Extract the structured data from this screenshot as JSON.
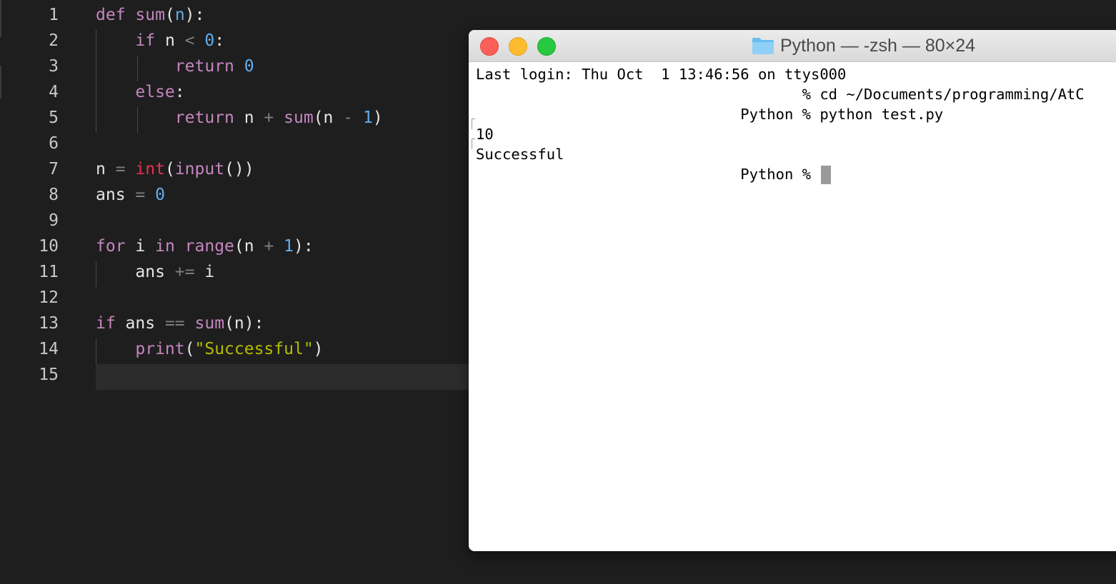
{
  "editor": {
    "line_numbers": [
      "1",
      "2",
      "3",
      "4",
      "5",
      "6",
      "7",
      "8",
      "9",
      "10",
      "11",
      "12",
      "13",
      "14",
      "15"
    ],
    "lines": [
      [
        {
          "t": "kw",
          "v": "def"
        },
        {
          "t": "plain",
          "v": " "
        },
        {
          "t": "fn",
          "v": "sum"
        },
        {
          "t": "plain",
          "v": "("
        },
        {
          "t": "num",
          "v": "n"
        },
        {
          "t": "plain",
          "v": "):"
        }
      ],
      [
        {
          "t": "plain",
          "v": "    "
        },
        {
          "t": "kw",
          "v": "if"
        },
        {
          "t": "plain",
          "v": " n "
        },
        {
          "t": "op",
          "v": "<"
        },
        {
          "t": "plain",
          "v": " "
        },
        {
          "t": "num",
          "v": "0"
        },
        {
          "t": "plain",
          "v": ":"
        }
      ],
      [
        {
          "t": "plain",
          "v": "        "
        },
        {
          "t": "kw",
          "v": "return"
        },
        {
          "t": "plain",
          "v": " "
        },
        {
          "t": "num",
          "v": "0"
        }
      ],
      [
        {
          "t": "plain",
          "v": "    "
        },
        {
          "t": "kw",
          "v": "else"
        },
        {
          "t": "plain",
          "v": ":"
        }
      ],
      [
        {
          "t": "plain",
          "v": "        "
        },
        {
          "t": "kw",
          "v": "return"
        },
        {
          "t": "plain",
          "v": " n "
        },
        {
          "t": "op",
          "v": "+"
        },
        {
          "t": "plain",
          "v": " "
        },
        {
          "t": "fn",
          "v": "sum"
        },
        {
          "t": "plain",
          "v": "(n "
        },
        {
          "t": "op",
          "v": "-"
        },
        {
          "t": "plain",
          "v": " "
        },
        {
          "t": "num",
          "v": "1"
        },
        {
          "t": "plain",
          "v": ")"
        }
      ],
      [],
      [
        {
          "t": "plain",
          "v": "n "
        },
        {
          "t": "op",
          "v": "="
        },
        {
          "t": "plain",
          "v": " "
        },
        {
          "t": "bi",
          "v": "int"
        },
        {
          "t": "plain",
          "v": "("
        },
        {
          "t": "fn",
          "v": "input"
        },
        {
          "t": "plain",
          "v": "())"
        }
      ],
      [
        {
          "t": "plain",
          "v": "ans "
        },
        {
          "t": "op",
          "v": "="
        },
        {
          "t": "plain",
          "v": " "
        },
        {
          "t": "num",
          "v": "0"
        }
      ],
      [],
      [
        {
          "t": "kw",
          "v": "for"
        },
        {
          "t": "plain",
          "v": " i "
        },
        {
          "t": "kw",
          "v": "in"
        },
        {
          "t": "plain",
          "v": " "
        },
        {
          "t": "fn",
          "v": "range"
        },
        {
          "t": "plain",
          "v": "(n "
        },
        {
          "t": "op",
          "v": "+"
        },
        {
          "t": "plain",
          "v": " "
        },
        {
          "t": "num",
          "v": "1"
        },
        {
          "t": "plain",
          "v": "):"
        }
      ],
      [
        {
          "t": "plain",
          "v": "    ans "
        },
        {
          "t": "op",
          "v": "+="
        },
        {
          "t": "plain",
          "v": " i"
        }
      ],
      [],
      [
        {
          "t": "kw",
          "v": "if"
        },
        {
          "t": "plain",
          "v": " ans "
        },
        {
          "t": "op",
          "v": "=="
        },
        {
          "t": "plain",
          "v": " "
        },
        {
          "t": "fn",
          "v": "sum"
        },
        {
          "t": "plain",
          "v": "(n):"
        }
      ],
      [
        {
          "t": "plain",
          "v": "    "
        },
        {
          "t": "fn",
          "v": "print"
        },
        {
          "t": "plain",
          "v": "("
        },
        {
          "t": "str",
          "v": "\"Successful\""
        },
        {
          "t": "plain",
          "v": ")"
        }
      ],
      []
    ]
  },
  "terminal": {
    "title": "Python — -zsh — 80×24",
    "lines": [
      "Last login: Thu Oct  1 13:46:56 on ttys000",
      "                                     % cd ~/Documents/programming/AtC",
      "                              Python % python test.py",
      "10",
      "Successful",
      "                              Python % "
    ]
  },
  "colors": {
    "editor_bg": "#1e1e1e",
    "keyword": "#c586c0",
    "builtin_int": "#e5334f",
    "number": "#61aeee",
    "string": "#b5bd00",
    "operator": "#7a7f85",
    "terminal_bg": "#ffffff",
    "traffic_close": "#fc5f57",
    "traffic_minimize": "#fdbc2e",
    "traffic_maximize": "#28c840"
  }
}
